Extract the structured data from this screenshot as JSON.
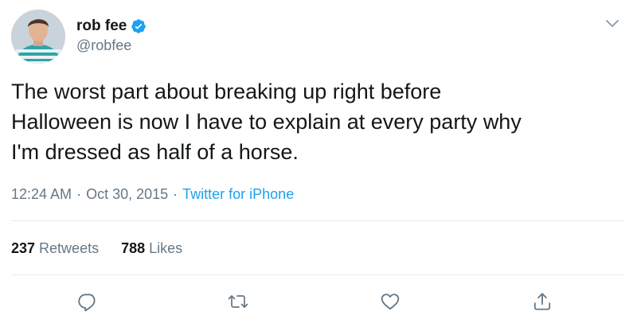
{
  "author": {
    "display_name": "rob fee",
    "handle": "@robfee",
    "verified": true
  },
  "tweet": {
    "text": "The worst part about breaking up right before\nHalloween is now I have to explain at every party why\nI'm dressed as half of a horse.",
    "time": "12:24 AM",
    "separator_1": "·",
    "date": "Oct 30, 2015",
    "separator_2": "·",
    "source": "Twitter for iPhone"
  },
  "stats": {
    "retweets_count": "237",
    "retweets_label": "Retweets",
    "likes_count": "788",
    "likes_label": "Likes"
  },
  "icons": {
    "caret": "chevron-down-icon",
    "verified": "verified-badge-icon",
    "reply": "reply-icon",
    "retweet": "retweet-icon",
    "like": "heart-icon",
    "share": "share-icon"
  },
  "colors": {
    "text": "#14171a",
    "secondary": "#657786",
    "accent": "#1da1f2",
    "divider": "#e6ecf0"
  }
}
